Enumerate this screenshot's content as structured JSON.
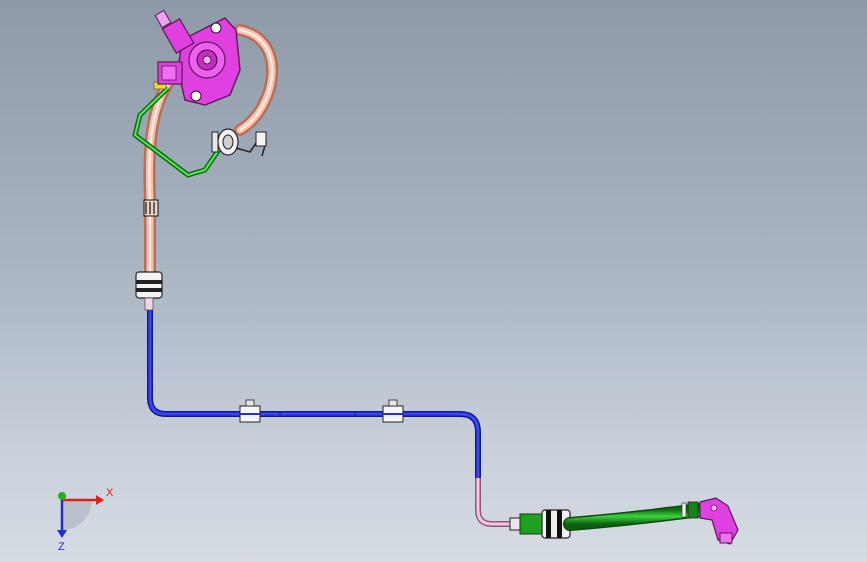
{
  "viewport": {
    "background_top": "#8e9aa8",
    "background_bottom": "#d6dce3"
  },
  "triad": {
    "x_label": "X",
    "z_label": "Z",
    "x_color": "#e0201a",
    "y_color": "#22b022",
    "z_color": "#2030d0"
  },
  "model": {
    "colors": {
      "copper_pipe": "#f0a890",
      "blue_pipe": "#2a30d8",
      "green_hose": "#20b020",
      "magenta_part": "#e040e0",
      "pink_section": "#f0c0e0",
      "yellow_ring": "#e8e020",
      "clip_white": "#f4f4f4"
    },
    "icons": [
      "injector-icon",
      "pump-flange-icon",
      "clamp-icon",
      "connector-icon",
      "nozzle-icon"
    ]
  }
}
